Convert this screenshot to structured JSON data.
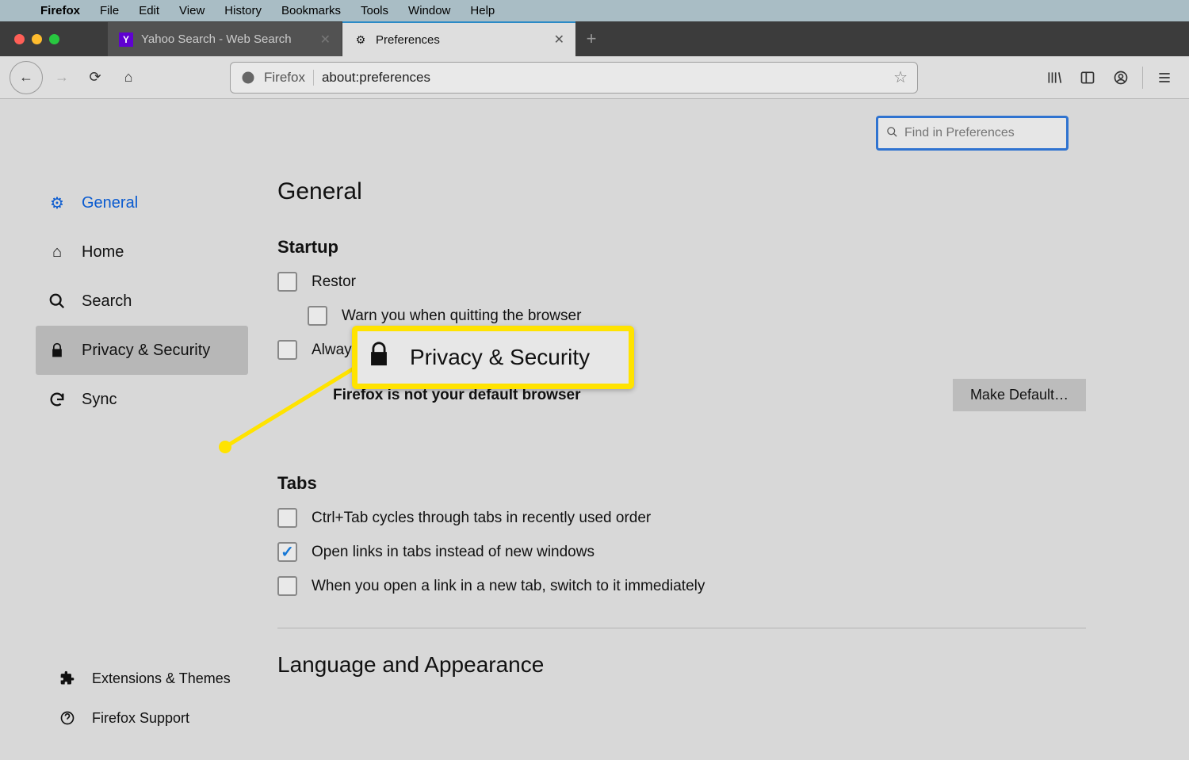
{
  "menubar": {
    "items": [
      "Firefox",
      "File",
      "Edit",
      "View",
      "History",
      "Bookmarks",
      "Tools",
      "Window",
      "Help"
    ]
  },
  "tabs": {
    "inactive": {
      "label": "Yahoo Search - Web Search"
    },
    "active": {
      "label": "Preferences"
    }
  },
  "urlbar": {
    "identity": "Firefox",
    "url": "about:preferences"
  },
  "findbox": {
    "placeholder": "Find in Preferences"
  },
  "sidebar": {
    "items": [
      {
        "label": "General"
      },
      {
        "label": "Home"
      },
      {
        "label": "Search"
      },
      {
        "label": "Privacy & Security"
      },
      {
        "label": "Sync"
      }
    ],
    "footer": [
      {
        "label": "Extensions & Themes"
      },
      {
        "label": "Firefox Support"
      }
    ]
  },
  "main": {
    "heading": "General",
    "startup": {
      "title": "Startup",
      "restore": "Restor",
      "warn": "Warn you when quitting the browser",
      "always_check": "Always check if Firefox is your default browser",
      "not_default": "Firefox is not your default browser",
      "make_default": "Make Default…"
    },
    "tabs_section": {
      "title": "Tabs",
      "ctrl_tab": "Ctrl+Tab cycles through tabs in recently used order",
      "open_links": "Open links in tabs instead of new windows",
      "switch_immediately": "When you open a link in a new tab, switch to it immediately"
    },
    "lang_heading": "Language and Appearance"
  },
  "callout": {
    "label": "Privacy & Security"
  }
}
